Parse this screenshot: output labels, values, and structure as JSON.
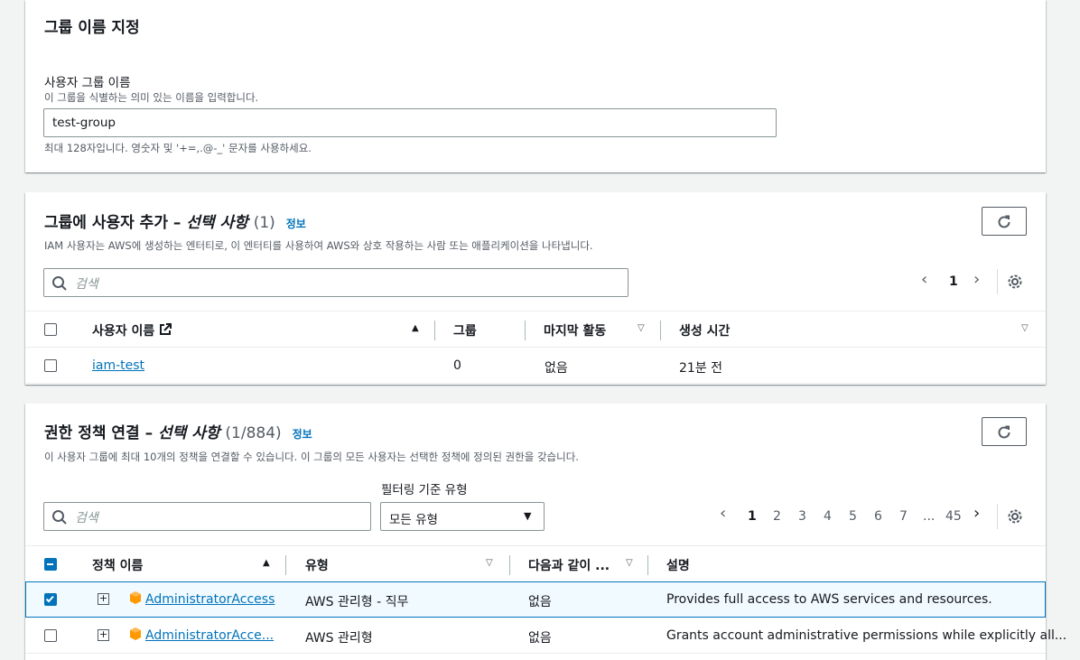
{
  "group_name_section": {
    "title": "그룹 이름 지정",
    "field_label": "사용자 그룹 이름",
    "field_desc": "이 그룹을 식별하는 의미 있는 이름을 입력합니다.",
    "field_value": "test-group",
    "constraint": "최대 128자입니다. 영숫자 및 '+=,.@-_' 문자를 사용하세요."
  },
  "users_section": {
    "title_prefix": "그룹에 사용자 추가 – ",
    "title_italic": "선택 사항",
    "count": "(1)",
    "info": "정보",
    "desc": "IAM 사용자는 AWS에 생성하는 엔터티로, 이 엔터티를 사용하여 AWS와 상호 작용하는 사람 또는 애플리케이션을 나타냅니다.",
    "search_placeholder": "검색",
    "page": "1",
    "columns": [
      "사용자 이름",
      "그룹",
      "마지막 활동",
      "생성 시간"
    ],
    "rows": [
      {
        "name": "iam-test",
        "groups": "0",
        "last_activity": "없음",
        "created": "21분 전"
      }
    ]
  },
  "policies_section": {
    "title_prefix": "권한 정책 연결 – ",
    "title_italic": "선택 사항",
    "count": "(1/884)",
    "info": "정보",
    "desc": "이 사용자 그룹에 최대 10개의 정책을 연결할 수 있습니다. 이 그룹의 모든 사용자는 선택한 정책에 정의된 권한을 갖습니다.",
    "search_placeholder": "검색",
    "filter_label": "필터링 기준 유형",
    "filter_value": "모든 유형",
    "pages": [
      "1",
      "2",
      "3",
      "4",
      "5",
      "6",
      "7",
      "...",
      "45"
    ],
    "columns": [
      "정책 이름",
      "유형",
      "다음과 같이 ...",
      "설명"
    ],
    "rows": [
      {
        "checked": true,
        "name": "AdministratorAccess",
        "type": "AWS 관리형 - 직무",
        "attached": "없음",
        "description": "Provides full access to AWS services and resources."
      },
      {
        "checked": false,
        "name": "AdministratorAcce...",
        "type": "AWS 관리형",
        "attached": "없음",
        "description": "Grants account administrative permissions while explicitly all..."
      }
    ]
  }
}
